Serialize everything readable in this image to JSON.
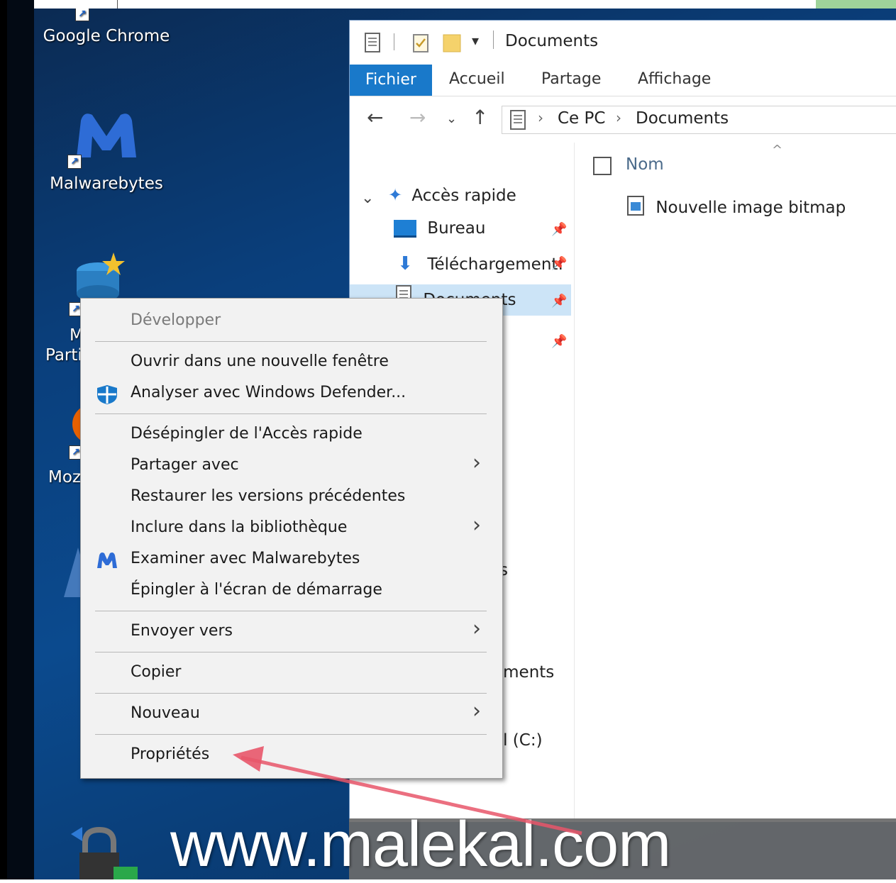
{
  "desktop": {
    "icons": [
      {
        "label": "Google Chrome"
      },
      {
        "label": "Malwarebytes"
      },
      {
        "label_partial_1": "M",
        "label_partial_2": "Parti"
      },
      {
        "label_partial": "Moz"
      }
    ]
  },
  "explorer": {
    "title": "Documents",
    "ribbon_tabs": [
      "Fichier",
      "Accueil",
      "Partage",
      "Affichage"
    ],
    "breadcrumb": [
      "Ce PC",
      "Documents"
    ],
    "nav": {
      "quick_access": "Accès rapide",
      "items": [
        "Bureau",
        "Téléchargement:",
        "Documents"
      ],
      "partial_labels": [
        "ts",
        "ements",
        "al (C:)"
      ]
    },
    "content": {
      "column_header": "Nom",
      "files": [
        "Nouvelle image bitmap"
      ]
    }
  },
  "context_menu": {
    "items": [
      "Développer",
      "Ouvrir dans une nouvelle fenêtre",
      "Analyser avec Windows Defender...",
      "Désépingler de l'Accès rapide",
      "Partager avec",
      "Restaurer les versions précédentes",
      "Inclure dans la bibliothèque",
      "Examiner avec Malwarebytes",
      "Épingler à l'écran de démarrage",
      "Envoyer vers",
      "Copier",
      "Nouveau",
      "Propriétés"
    ]
  },
  "watermark": "www.malekal.com",
  "colors": {
    "accent": "#1979ca",
    "desktop": "#0a3f7c",
    "annotation_arrow": "#e8566a"
  }
}
